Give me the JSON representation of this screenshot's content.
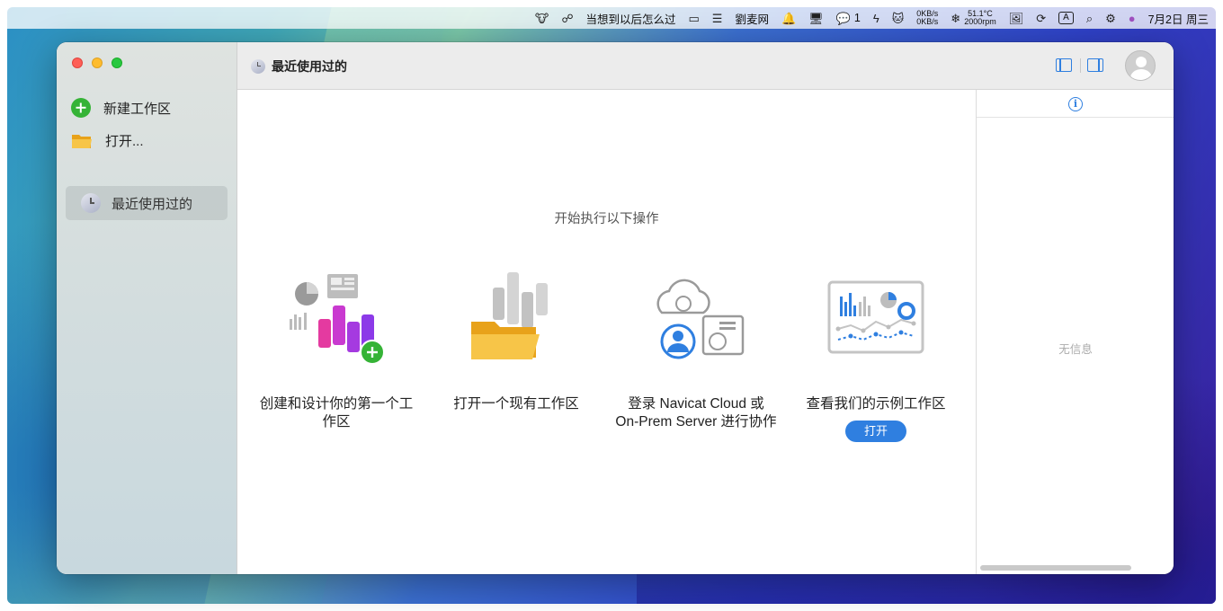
{
  "menubar": {
    "items": [
      {
        "icon": "cow-icon",
        "text": ""
      },
      {
        "icon": "link-icon",
        "text": ""
      },
      {
        "icon": "",
        "text": "当想到以后怎么过"
      },
      {
        "icon": "display-icon",
        "text": ""
      },
      {
        "icon": "list-icon",
        "text": ""
      },
      {
        "icon": "",
        "text": "劉麦网"
      },
      {
        "icon": "bell-icon",
        "text": ""
      },
      {
        "icon": "monitor-icon",
        "text": ""
      },
      {
        "icon": "wechat-icon",
        "text": "1"
      },
      {
        "icon": "flash-icon",
        "text": ""
      },
      {
        "icon": "cat-icon",
        "text": ""
      }
    ],
    "network": {
      "up": "0KB/s",
      "down": "0KB/s"
    },
    "sensors": {
      "temp": "51.1°C",
      "fan": "2000rpm"
    },
    "input_method": "A",
    "datetime": "7月2日 周三"
  },
  "window": {
    "toolbar_title": "最近使用过的"
  },
  "sidebar": {
    "new_workspace": "新建工作区",
    "open": "打开...",
    "recent": "最近使用过的"
  },
  "main": {
    "heading": "开始执行以下操作",
    "cards": [
      {
        "label": "创建和设计你的第一个工作区"
      },
      {
        "label": "打开一个现有工作区"
      },
      {
        "label": "登录 Navicat Cloud 或 On-Prem Server 进行协作"
      },
      {
        "label": "查看我们的示例工作区",
        "button": "打开"
      }
    ]
  },
  "info_panel": {
    "icon": "info-icon",
    "empty_text": "无信息"
  },
  "colors": {
    "accent": "#2f7fe0",
    "add_green": "#35b336"
  }
}
